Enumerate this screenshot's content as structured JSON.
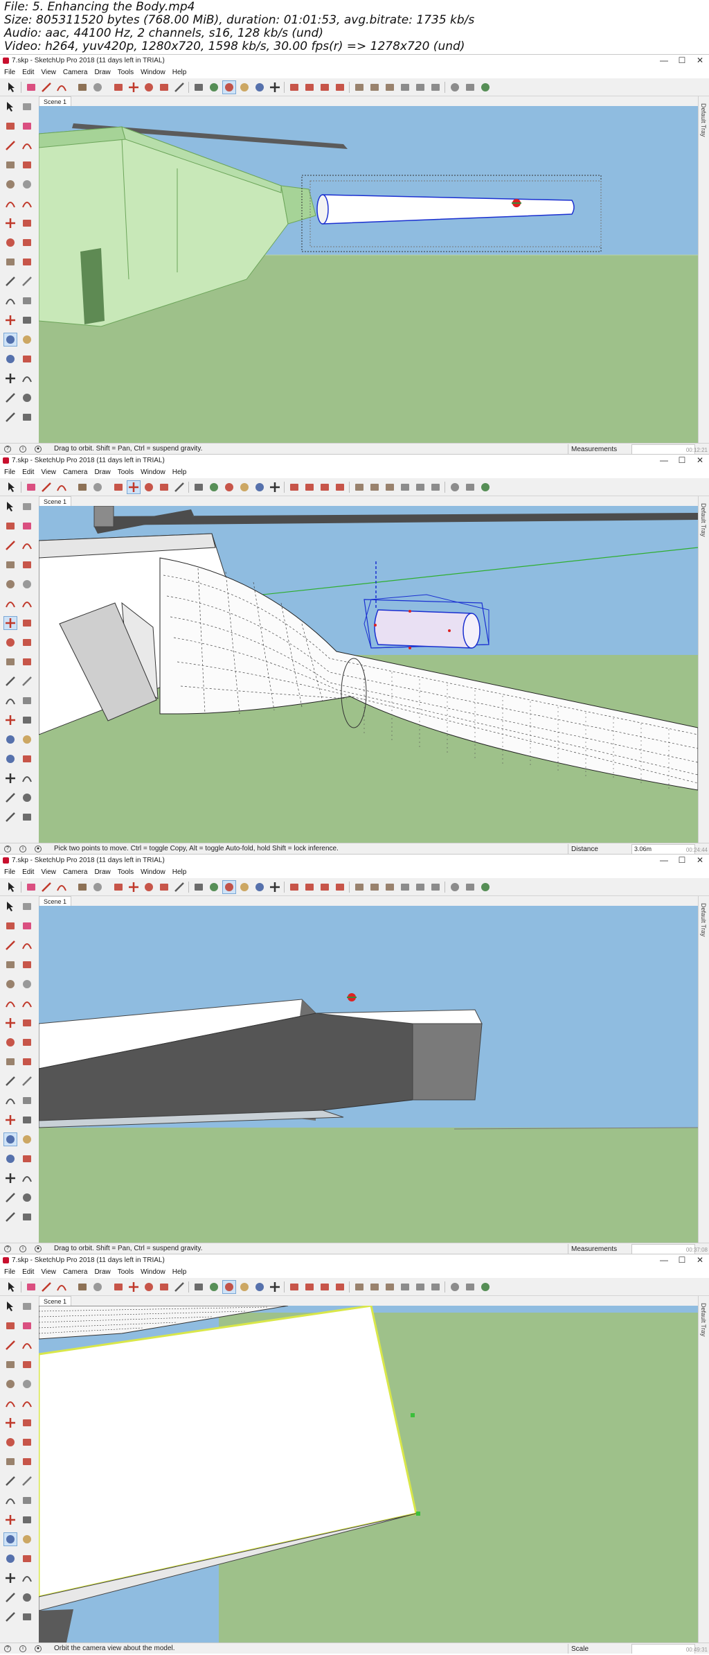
{
  "file_info": {
    "line1": "File: 5. Enhancing the Body.mp4",
    "line2": "Size: 805311520 bytes (768.00 MiB), duration: 01:01:53, avg.bitrate: 1735 kb/s",
    "line3": "Audio: aac, 44100 Hz, 2 channels, s16, 128 kb/s (und)",
    "line4": "Video: h264, yuv420p, 1280x720, 1598 kb/s, 30.00 fps(r) => 1278x720 (und)"
  },
  "app": {
    "window_title": "7.skp - SketchUp Pro 2018 (11 days left in TRIAL)",
    "menus": [
      "File",
      "Edit",
      "View",
      "Camera",
      "Draw",
      "Tools",
      "Window",
      "Help"
    ],
    "scene_tab": "Scene 1",
    "tray_label": "Default Tray",
    "window_controls": {
      "minimize": "—",
      "maximize": "☐",
      "close": "✕"
    }
  },
  "panels": [
    {
      "status_message": "Drag to orbit. Shift = Pan, Ctrl = suspend gravity.",
      "measure_label": "Measurements",
      "measure_value": "",
      "timestamp": "00:12:21",
      "active_tool": "orbit"
    },
    {
      "status_message": "Pick two points to move.  Ctrl = toggle Copy, Alt = toggle Auto-fold, hold Shift = lock inference.",
      "measure_label": "Distance",
      "measure_value": "3.06m",
      "timestamp": "00:24:44",
      "active_tool": "move"
    },
    {
      "status_message": "Drag to orbit. Shift = Pan, Ctrl = suspend gravity.",
      "measure_label": "Measurements",
      "measure_value": "",
      "timestamp": "00:37:08",
      "active_tool": "orbit"
    },
    {
      "status_message": "Orbit the camera view about the model.",
      "measure_label": "Scale",
      "measure_value": "",
      "timestamp": "00:49:31",
      "active_tool": "orbit"
    }
  ],
  "colors": {
    "sky": "#8fbce0",
    "ground": "#9ec18a",
    "selection_blue": "#1a2fd0",
    "chrome": "#f0f0f0"
  }
}
